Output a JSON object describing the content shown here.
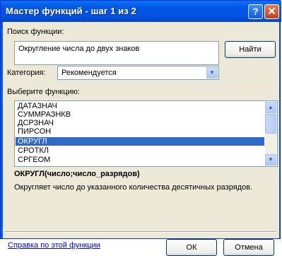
{
  "window": {
    "title": "Мастер функций - шаг 1 из 2",
    "help_glyph": "?",
    "close_glyph": "✕"
  },
  "search": {
    "label": "Поиск функции:",
    "value": "Округление числа до двух знаков",
    "button_label": "Найти"
  },
  "category": {
    "label": "Категория:",
    "selected": "Рекомендуется",
    "arrow_glyph": "▼"
  },
  "function_list": {
    "label": "Выберите функцию:",
    "items": [
      {
        "label": "ДАТАЗНАЧ"
      },
      {
        "label": "СУММРАЗНКВ"
      },
      {
        "label": "ДСРЗНАЧ"
      },
      {
        "label": "ПИРСОН"
      },
      {
        "label": "ОКРУГЛ"
      },
      {
        "label": "СРОТКЛ"
      },
      {
        "label": "СРГЕОМ"
      }
    ],
    "selected_index": 4,
    "scroll_up_glyph": "▲",
    "scroll_down_glyph": "▼"
  },
  "details": {
    "signature": "ОКРУГЛ(число;число_разрядов)",
    "description": "Округляет число до указанного количества десятичных разрядов."
  },
  "footer": {
    "help_link": "Справка по этой функции",
    "ok_label": "ОК",
    "cancel_label": "Отмена"
  },
  "colors": {
    "title_bar": "#0058e6",
    "dialog_bg": "#ece9d8",
    "selection": "#316ac5",
    "link": "#0000ff"
  }
}
